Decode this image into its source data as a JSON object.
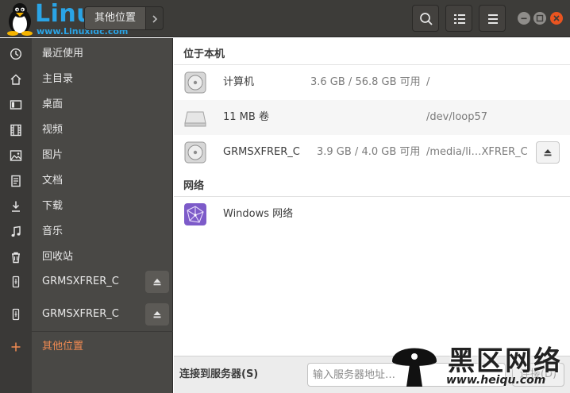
{
  "watermark_top": {
    "brand": "Linux",
    "url": "www.Linuxidc.com"
  },
  "header": {
    "path_label": "其他位置",
    "colors": {
      "bar": "#3d3c39",
      "close": "#e95420",
      "accent": "#f08a52"
    }
  },
  "sidebar": {
    "items": [
      {
        "label": "最近使用",
        "icon": "recent-icon"
      },
      {
        "label": "主目录",
        "icon": "home-icon"
      },
      {
        "label": "桌面",
        "icon": "desktop-icon"
      },
      {
        "label": "视频",
        "icon": "video-icon"
      },
      {
        "label": "图片",
        "icon": "picture-icon"
      },
      {
        "label": "文档",
        "icon": "document-icon"
      },
      {
        "label": "下载",
        "icon": "download-icon"
      },
      {
        "label": "音乐",
        "icon": "music-icon"
      },
      {
        "label": "回收站",
        "icon": "trash-icon"
      },
      {
        "label": "GRMSXFRER_C",
        "icon": "usb-icon"
      },
      {
        "label": "GRMSXFRER_C",
        "icon": "usb-icon"
      },
      {
        "label": "其他位置",
        "icon": "plus-icon"
      }
    ]
  },
  "main": {
    "section_local": "位于本机",
    "section_network": "网络",
    "local": [
      {
        "name": "计算机",
        "size": "3.6 GB / 56.8 GB 可用",
        "path": "/"
      },
      {
        "name": "11 MB 卷",
        "size": "",
        "path": "/dev/loop57"
      },
      {
        "name": "GRMSXFRER_C",
        "size": "3.9 GB / 4.0 GB 可用",
        "path": "/media/li…XFRER_C"
      }
    ],
    "network": [
      {
        "name": "Windows 网络"
      }
    ]
  },
  "bottom": {
    "connect_label": "连接到服务器(S)",
    "server_placeholder": "输入服务器地址…",
    "connect_button": "连接(D)"
  },
  "watermark_bottom": {
    "brand": "黑区网络",
    "url": "www.heiqu.com"
  }
}
